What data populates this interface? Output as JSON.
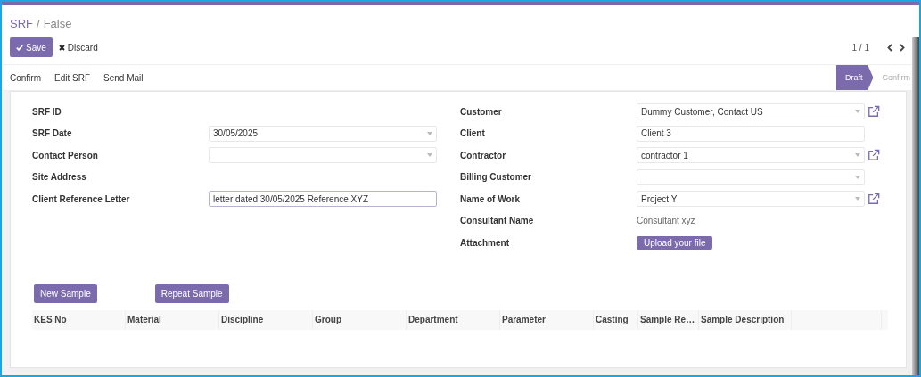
{
  "breadcrumb": [
    {
      "label": "SRF",
      "kind": "link"
    },
    {
      "label": "False",
      "kind": "current"
    }
  ],
  "breadcrumb_separator": "/",
  "buttons": [
    {
      "label": "Save",
      "kind": "primary"
    },
    {
      "label": "Discard",
      "kind": "secondary"
    }
  ],
  "pager": {
    "text": "1 / 1"
  },
  "actions": [
    "Confirm",
    "Edit SRF",
    "Send Mail"
  ],
  "stages": [
    {
      "label": "Draft",
      "selected": true
    },
    {
      "label": "Confirm",
      "selected": false
    }
  ],
  "left_fields": [
    {
      "label": "SRF ID",
      "kind": "empty"
    },
    {
      "label": "SRF Date",
      "kind": "select",
      "value": "30/05/2025",
      "link": false
    },
    {
      "label": "Contact Person",
      "kind": "select",
      "link": false
    },
    {
      "label": "Site Address",
      "kind": "empty"
    },
    {
      "label": "Client Reference Letter",
      "kind": "input",
      "value": "letter dated 30/05/2025 Reference XYZ",
      "focused": true
    }
  ],
  "right_fields": [
    {
      "label": "Customer",
      "kind": "select",
      "value": "Dummy Customer, Contact US",
      "link": true
    },
    {
      "label": "Client",
      "kind": "input",
      "value": "Client 3",
      "focused": false
    },
    {
      "label": "Contractor",
      "kind": "select",
      "value": "contractor 1",
      "link": true
    },
    {
      "label": "Billing Customer",
      "kind": "select",
      "link": false
    },
    {
      "label": "Name of Work",
      "kind": "select",
      "value": "Project Y",
      "link": true
    },
    {
      "label": "Consultant Name",
      "kind": "text",
      "value": "Consultant xyz"
    },
    {
      "label": "Attachment",
      "kind": "button",
      "value": "Upload your file"
    }
  ],
  "sample_buttons": [
    "New Sample",
    "Repeat Sample"
  ],
  "table": {
    "columns": [
      "KES No",
      "Material",
      "Discipline",
      "Group",
      "Department",
      "Parameter",
      "Casting",
      "Sample Re…",
      "Sample Description"
    ]
  }
}
